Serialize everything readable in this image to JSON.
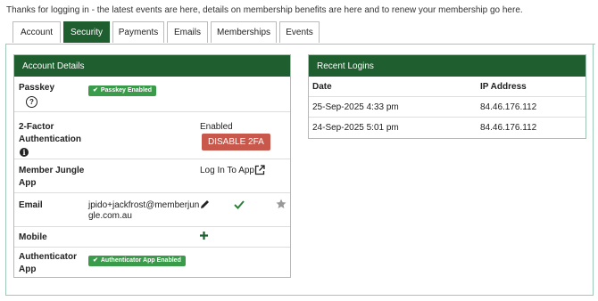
{
  "intro_text": "Thanks for logging in - the latest events are here, details on membership benefits are here and to renew your membership go here.",
  "tabs": [
    {
      "label": "Account"
    },
    {
      "label": "Security"
    },
    {
      "label": "Payments"
    },
    {
      "label": "Emails"
    },
    {
      "label": "Memberships"
    },
    {
      "label": "Events"
    }
  ],
  "active_tab": "Security",
  "account_details": {
    "title": "Account Details",
    "passkey": {
      "label": "Passkey",
      "badge": "Passkey Enabled"
    },
    "two_factor": {
      "label_line1": "2-Factor",
      "label_line2": "Authentication",
      "status": "Enabled",
      "button": "DISABLE 2FA"
    },
    "member_jungle": {
      "label_line1": "Member Jungle",
      "label_line2": "App",
      "link": "Log In To App"
    },
    "email": {
      "label": "Email",
      "value_line1": "jpido+jackfrost@memberjun",
      "value_line2": "gle.com.au"
    },
    "mobile": {
      "label": "Mobile"
    },
    "authenticator": {
      "label_line1": "Authenticator",
      "label_line2": "App",
      "badge": "Authenticator App Enabled"
    }
  },
  "recent_logins": {
    "title": "Recent Logins",
    "columns": [
      "Date",
      "IP Address"
    ],
    "rows": [
      {
        "date": "25-Sep-2025 4:33 pm",
        "ip": "84.46.176.112"
      },
      {
        "date": "24-Sep-2025 5:01 pm",
        "ip": "84.46.176.112"
      }
    ]
  },
  "colors": {
    "brand_green": "#1e5e2f",
    "badge_green": "#3a9b4a",
    "danger": "#c9584c"
  }
}
